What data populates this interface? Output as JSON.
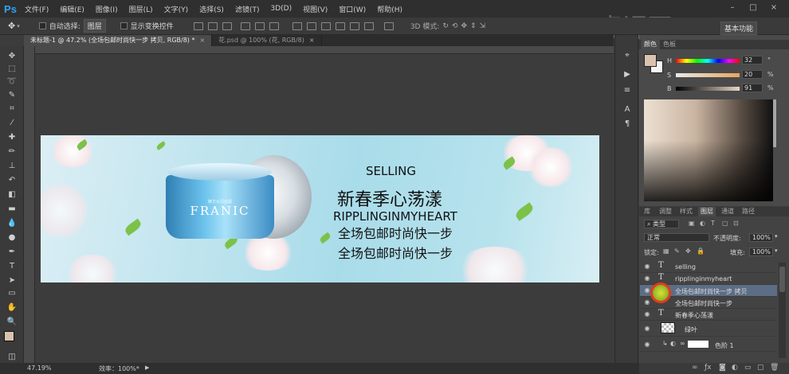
{
  "app": {
    "logo": "Ps",
    "menu": [
      "文件(F)",
      "编辑(E)",
      "图像(I)",
      "图层(L)",
      "文字(Y)",
      "选择(S)",
      "滤镜(T)",
      "3D(D)",
      "视图(V)",
      "窗口(W)",
      "帮助(H)"
    ],
    "window_buttons": [
      "–",
      "□",
      "×"
    ],
    "watermark": "虎课网"
  },
  "options_bar": {
    "auto_select_label": "自动选择:",
    "auto_select_value": "图层",
    "show_transform_label": "显示变换控件",
    "mode_3d_label": "3D 模式:",
    "workspace_label": "基本功能"
  },
  "tabs": [
    {
      "label": "未标题-1 @ 47.2% (全场包邮时尚快一步 拷贝, RGB/8) *",
      "close": "×"
    },
    {
      "label": "花.psd @ 100% (花, RGB/8)",
      "close": "×"
    }
  ],
  "banner": {
    "brand": "FRANIC",
    "brand_sub": "精华水润面霜",
    "line1": "SELLING",
    "line2": "新春季心荡漾",
    "line3": "RIPPLINGINMYHEART",
    "line4": "全场包邮时尚快一步",
    "line5": "全场包邮时尚快一步"
  },
  "color_panel": {
    "tabs": [
      "颜色",
      "色板"
    ],
    "sliders": [
      {
        "label": "H",
        "value": "32",
        "unit": "°"
      },
      {
        "label": "S",
        "value": "20",
        "unit": "%"
      },
      {
        "label": "B",
        "value": "91",
        "unit": "%"
      }
    ]
  },
  "layers_panel": {
    "tabs": [
      "库",
      "调整",
      "样式",
      "图层",
      "通道",
      "路径"
    ],
    "kind_filter": "类型",
    "blend_mode": "正常",
    "opacity_label": "不透明度:",
    "opacity_value": "100%",
    "lock_label": "锁定:",
    "fill_label": "填充:",
    "fill_value": "100%",
    "layers": [
      {
        "name": "selling",
        "type": "text"
      },
      {
        "name": "ripplinginmyheart",
        "type": "text"
      },
      {
        "name": "全场包邮时尚快一步 拷贝",
        "type": "text",
        "selected": true
      },
      {
        "name": "全场包邮时尚快一步",
        "type": "text"
      },
      {
        "name": "新春季心荡漾",
        "type": "text"
      },
      {
        "name": "绿叶",
        "type": "image"
      },
      {
        "name": "色阶 1",
        "type": "adjustment"
      }
    ]
  },
  "statusbar": {
    "zoom": "47.19%",
    "efficiency": "效率：100%*"
  }
}
